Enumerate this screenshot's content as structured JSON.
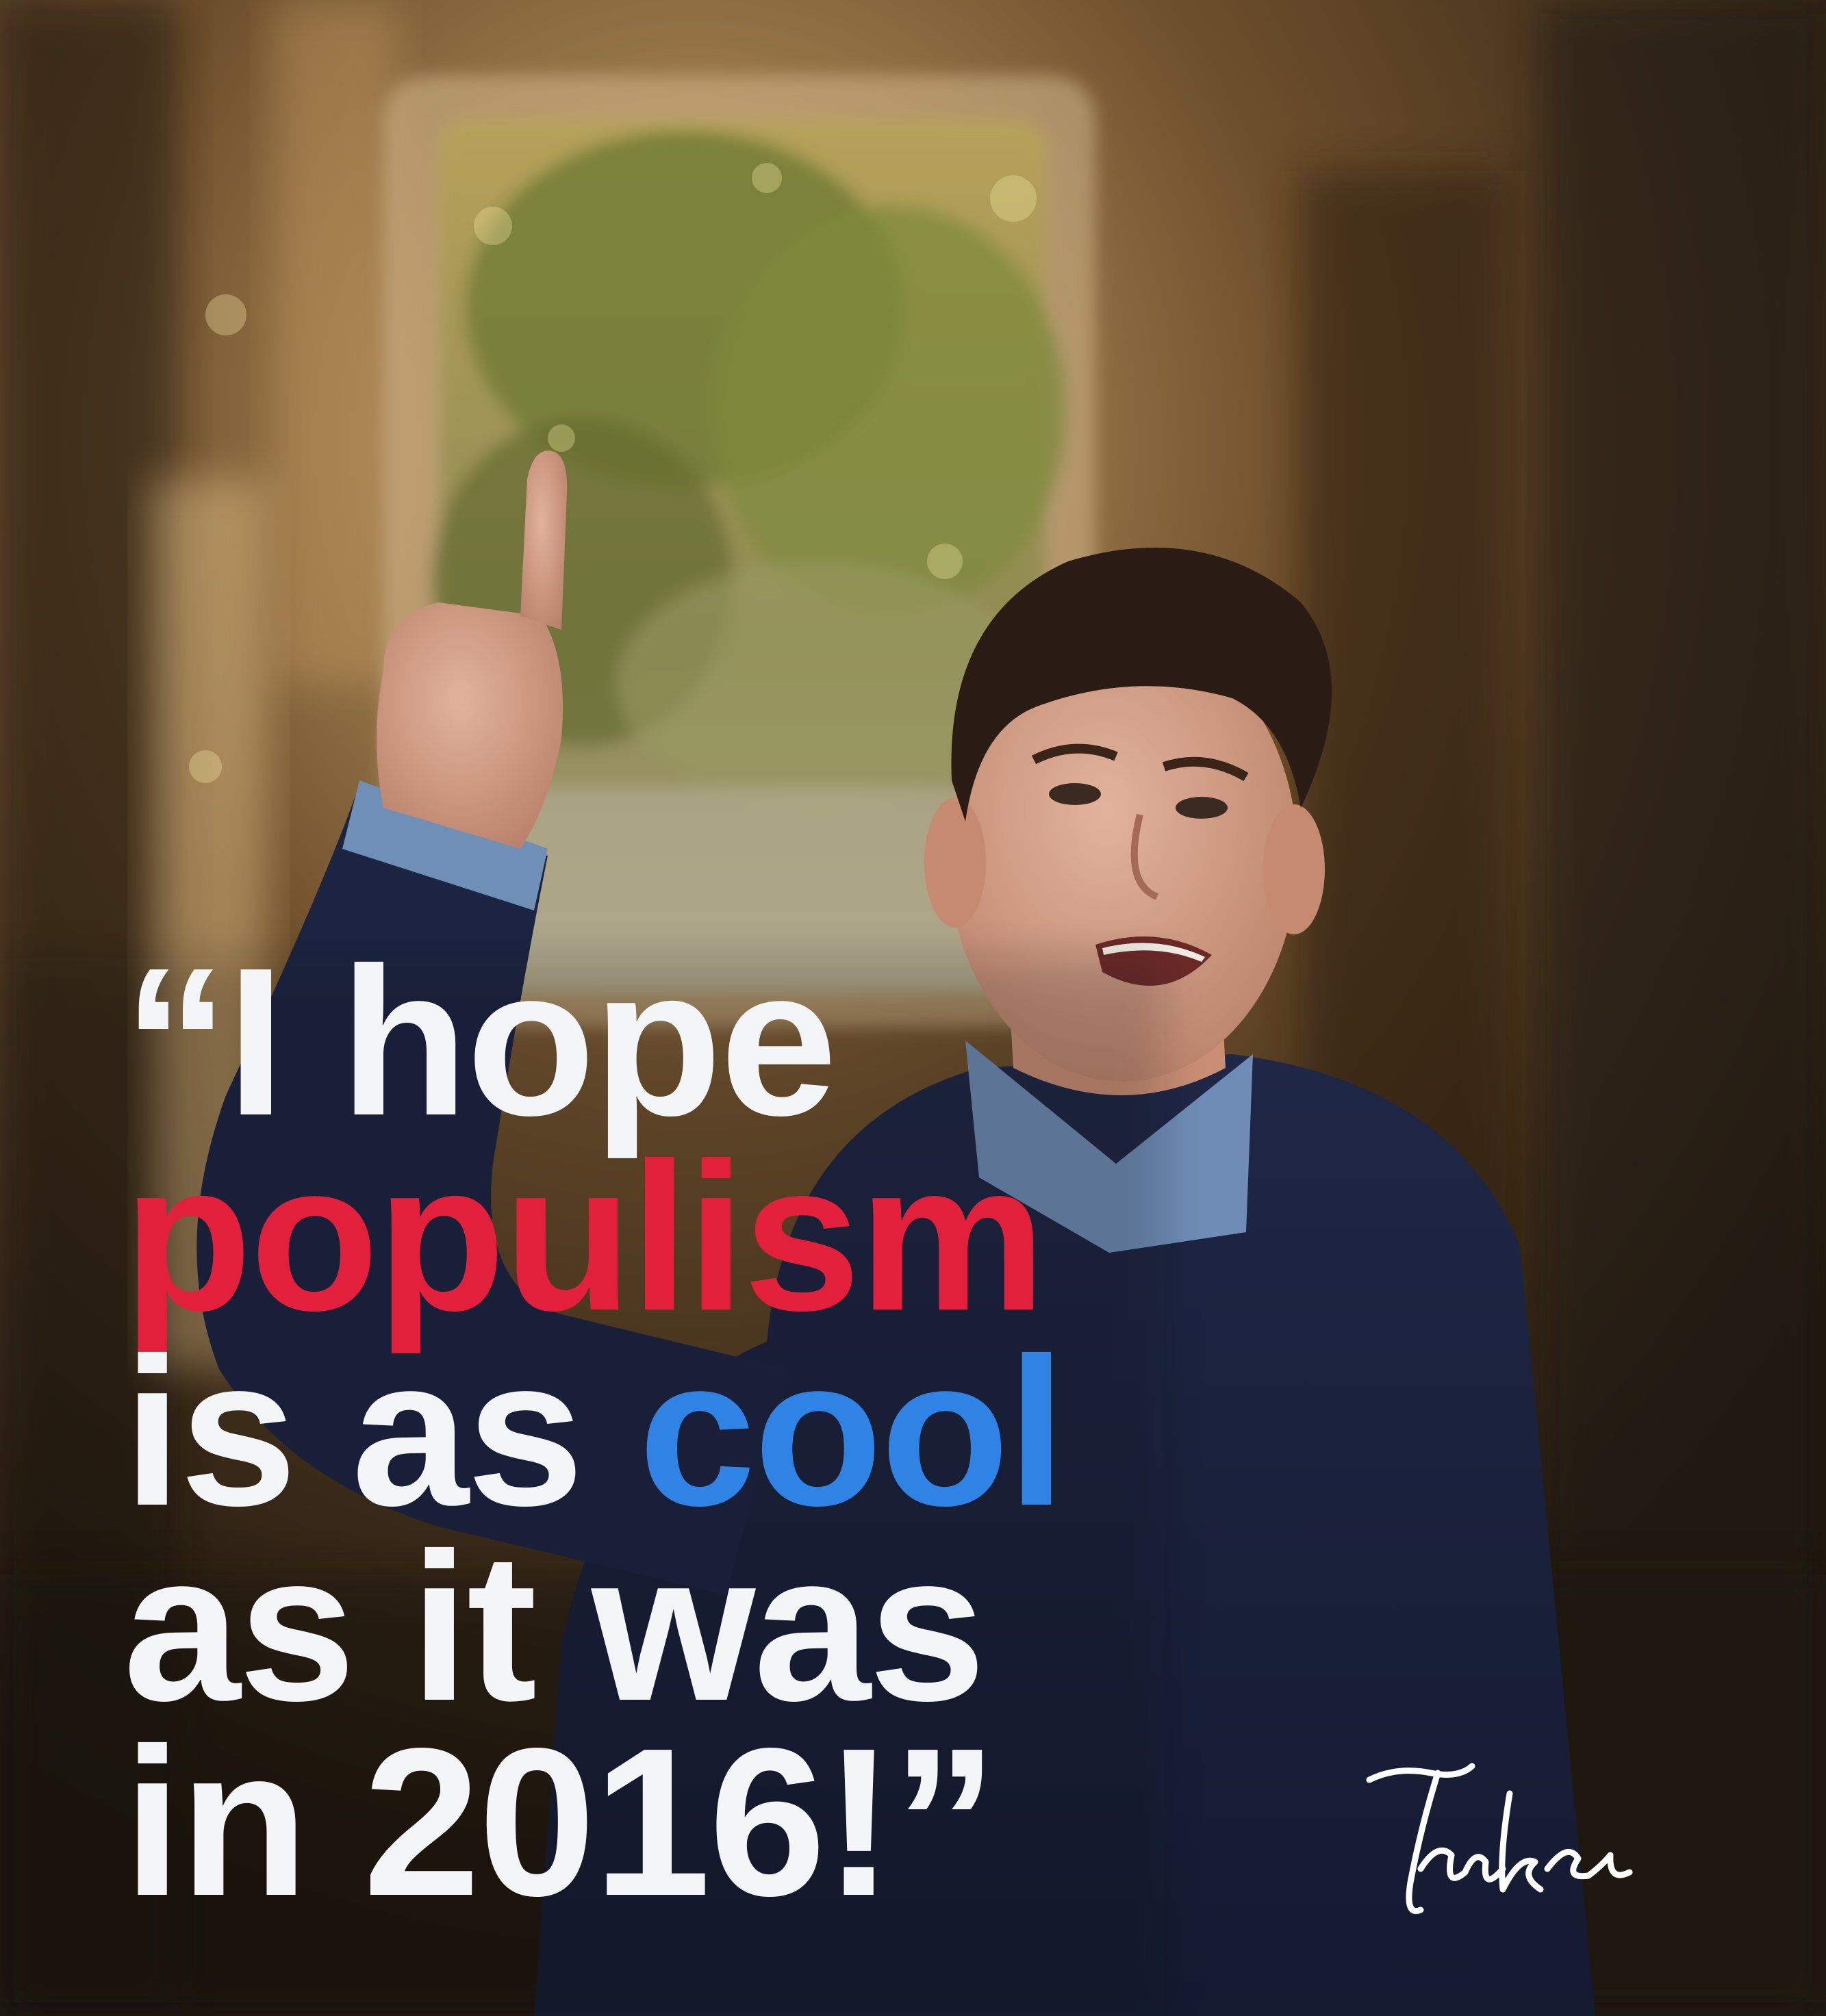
{
  "quote": {
    "line1": "“I hope",
    "line2_accent": "populism",
    "line3_lead": "is as ",
    "line3_accent": "cool",
    "line4": "as it was",
    "line5": "in 2016!”"
  },
  "signature": {
    "text": "Tucker"
  },
  "colors": {
    "text_primary": "#f4f5f7",
    "accent_red": "#e3203b",
    "accent_blue": "#2f83e5",
    "sweater_navy": "#1b2340",
    "background_warm": "#5c4226",
    "foliage": "#8a8a3e"
  },
  "photo": {
    "subject": "person-pointing-up",
    "setting": "stone-archway-with-foliage"
  }
}
